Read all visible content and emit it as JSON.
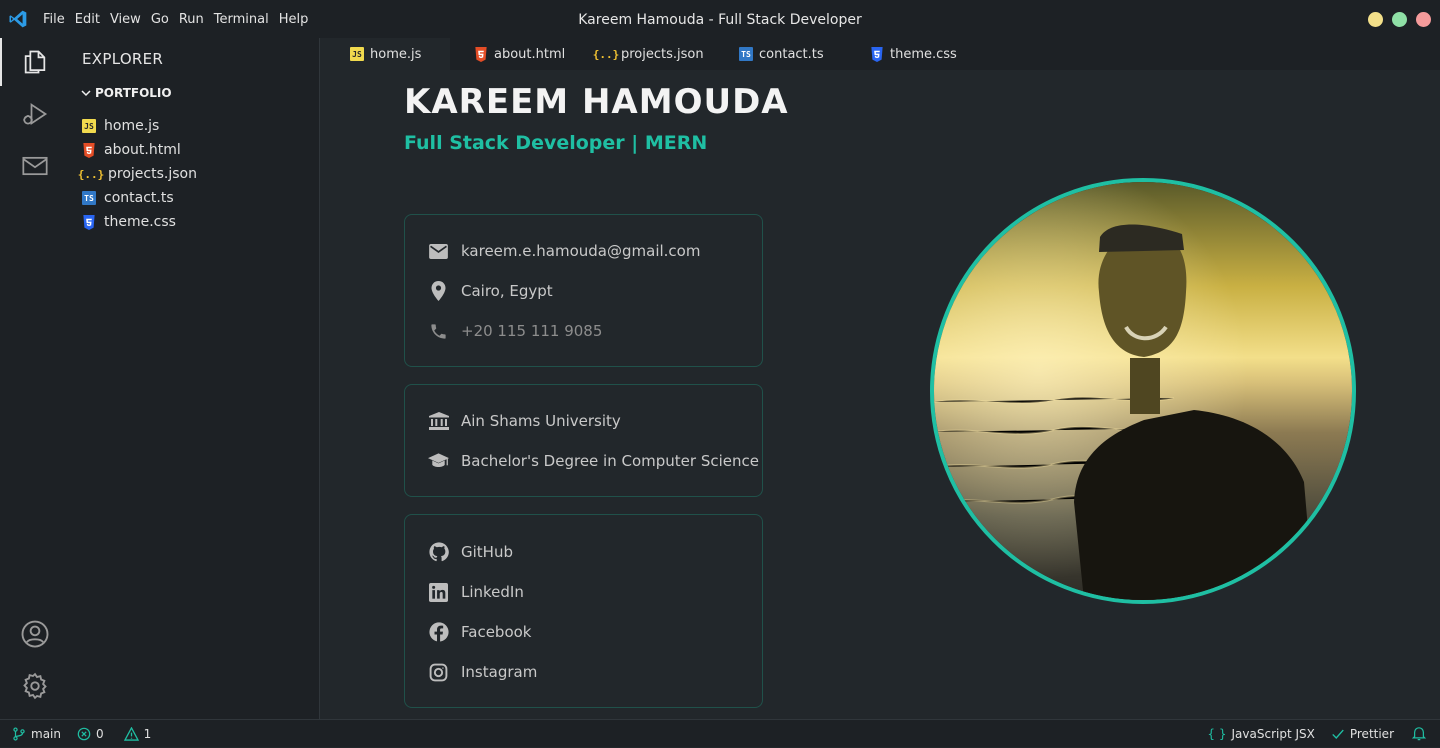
{
  "titlebar": {
    "title": "Kareem Hamouda - Full Stack Developer",
    "menu": [
      "File",
      "Edit",
      "View",
      "Go",
      "Run",
      "Terminal",
      "Help"
    ],
    "dots": [
      "#f3e08a",
      "#8fe0a6",
      "#f59b9b"
    ]
  },
  "sidebar": {
    "title": "EXPLORER",
    "folder": "PORTFOLIO",
    "files": [
      {
        "label": "home.js",
        "icon": "js-file-icon"
      },
      {
        "label": "about.html",
        "icon": "html-file-icon"
      },
      {
        "label": "projects.json",
        "icon": "json-file-icon"
      },
      {
        "label": "contact.ts",
        "icon": "ts-file-icon"
      },
      {
        "label": "theme.css",
        "icon": "css-file-icon"
      }
    ]
  },
  "tabs": [
    {
      "label": "home.js",
      "icon": "js-file-icon"
    },
    {
      "label": "about.html",
      "icon": "html-file-icon"
    },
    {
      "label": "projects.json",
      "icon": "json-file-icon"
    },
    {
      "label": "contact.ts",
      "icon": "ts-file-icon"
    },
    {
      "label": "theme.css",
      "icon": "css-file-icon"
    }
  ],
  "profile": {
    "name": "KAREEM HAMOUDA",
    "role": "Full Stack Developer | MERN",
    "contact": {
      "email": "kareem.e.hamouda@gmail.com",
      "location": "Cairo, Egypt",
      "phone": "+20 115 111 9085"
    },
    "education": {
      "university": "Ain Shams University",
      "degree": "Bachelor's Degree in Computer Science"
    },
    "social": [
      "GitHub",
      "LinkedIn",
      "Facebook",
      "Instagram"
    ]
  },
  "statusbar": {
    "branch": "main",
    "errors": "0",
    "warnings": "1",
    "language": "JavaScript JSX",
    "formatter": "Prettier"
  },
  "colors": {
    "accent": "#1fbfa3",
    "background": "#22272b",
    "panel": "#1d2125"
  }
}
